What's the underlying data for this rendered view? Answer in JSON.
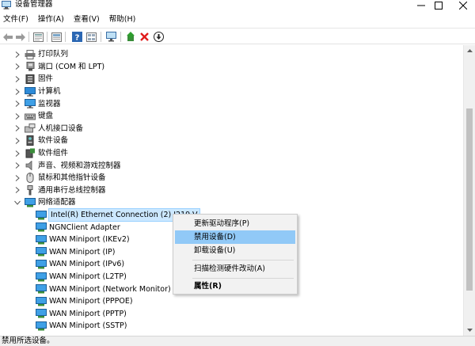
{
  "window": {
    "title": "设备管理器",
    "icon": "device-manager-icon"
  },
  "menu": [
    {
      "label": "文件(F)"
    },
    {
      "label": "操作(A)"
    },
    {
      "label": "查看(V)"
    },
    {
      "label": "帮助(H)"
    }
  ],
  "toolbar": {
    "buttons": [
      "back-icon",
      "forward-icon",
      "properties-icon",
      "driver-icon",
      "help-icon",
      "monitor-scan-icon",
      "update-driver-icon",
      "uninstall-icon",
      "disable-icon"
    ]
  },
  "tree": [
    {
      "label": "打印队列",
      "icon": "printer-icon",
      "expanded": false
    },
    {
      "label": "端口 (COM 和 LPT)",
      "icon": "port-icon",
      "expanded": false
    },
    {
      "label": "固件",
      "icon": "firmware-icon",
      "expanded": false
    },
    {
      "label": "计算机",
      "icon": "computer-icon",
      "expanded": false
    },
    {
      "label": "监视器",
      "icon": "monitor-icon",
      "expanded": false
    },
    {
      "label": "键盘",
      "icon": "keyboard-icon",
      "expanded": false
    },
    {
      "label": "人机接口设备",
      "icon": "hid-icon",
      "expanded": false
    },
    {
      "label": "软件设备",
      "icon": "software-device-icon",
      "expanded": false
    },
    {
      "label": "软件组件",
      "icon": "software-component-icon",
      "expanded": false
    },
    {
      "label": "声音、视频和游戏控制器",
      "icon": "speaker-icon",
      "expanded": false
    },
    {
      "label": "鼠标和其他指针设备",
      "icon": "mouse-icon",
      "expanded": false
    },
    {
      "label": "通用串行总线控制器",
      "icon": "usb-icon",
      "expanded": false
    },
    {
      "label": "网络适配器",
      "icon": "network-adapter-icon",
      "expanded": true
    }
  ],
  "network_adapters": [
    {
      "label": "Intel(R) Ethernet Connection (2) I219-V",
      "selected": true
    },
    {
      "label": "NGNClient Adapter"
    },
    {
      "label": "WAN Miniport (IKEv2)"
    },
    {
      "label": "WAN Miniport (IP)"
    },
    {
      "label": "WAN Miniport (IPv6)"
    },
    {
      "label": "WAN Miniport (L2TP)"
    },
    {
      "label": "WAN Miniport (Network Monitor)"
    },
    {
      "label": "WAN Miniport (PPPOE)"
    },
    {
      "label": "WAN Miniport (PPTP)"
    },
    {
      "label": "WAN Miniport (SSTP)"
    }
  ],
  "context_menu": {
    "items": [
      {
        "label": "更新驱动程序(P)"
      },
      {
        "label": "禁用设备(D)",
        "highlighted": true
      },
      {
        "label": "卸载设备(U)"
      },
      {
        "label": "扫描检测硬件改动(A)"
      },
      {
        "label": "属性(R)",
        "bold": true
      }
    ]
  },
  "status": {
    "text": "禁用所选设备。"
  },
  "colors": {
    "selection_bg": "#cce8ff",
    "menu_hover": "#91c9f7",
    "menu_bg": "#f2f2f2"
  }
}
